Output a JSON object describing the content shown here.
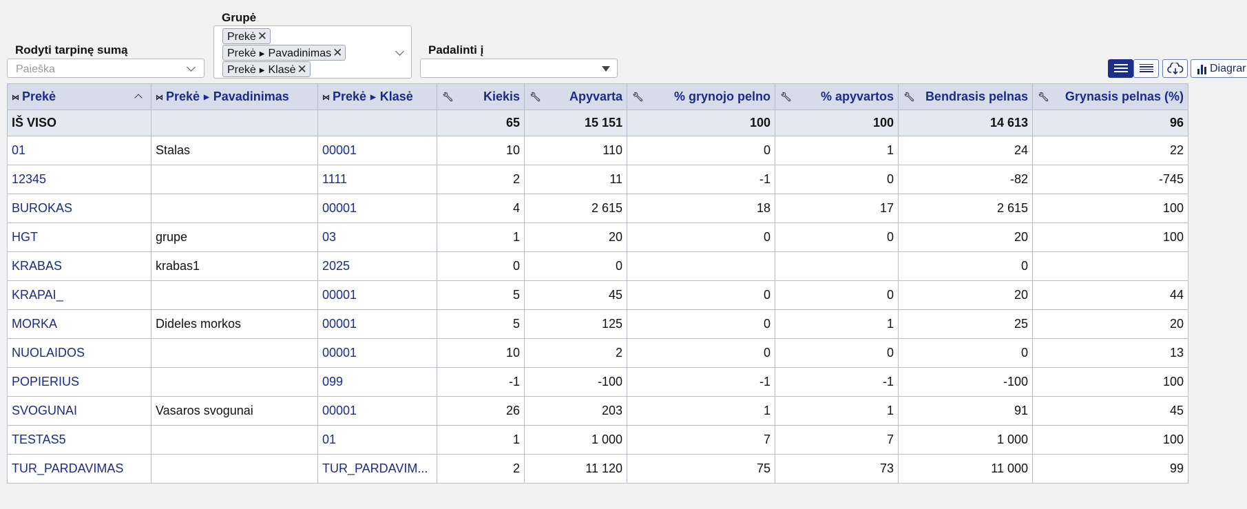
{
  "filters": {
    "subtotal_label": "Rodyti tarpinę sumą",
    "subtotal_placeholder": "Paieška",
    "group_label": "Grupė",
    "group_tags": [
      {
        "parts": [
          "Prekė"
        ]
      },
      {
        "parts": [
          "Prekė",
          "Pavadinimas"
        ]
      },
      {
        "parts": [
          "Prekė",
          "Klasė"
        ]
      }
    ],
    "split_label": "Padalinti į",
    "split_value": ""
  },
  "toolbar": {
    "diagram_label": "Diagrar"
  },
  "table": {
    "columns": [
      "Prekė",
      "Pavadinimas",
      "Klasė",
      "Kiekis",
      "Apyvarta",
      "% grynojo pelno",
      "% apyvartos",
      "Bendrasis pelnas",
      "Grynasis pelnas (%)"
    ],
    "column_prefix": "Prekė",
    "total": {
      "label": "IŠ VISO",
      "kiekis": "65",
      "apyvarta": "15 151",
      "gryn_pct": "100",
      "apyv_pct": "100",
      "bendr": "14 613",
      "gryn_pelnas": "96"
    },
    "rows": [
      {
        "preke": "01",
        "pav": "Stalas",
        "klase": "00001",
        "kiekis": "10",
        "apyvarta": "110",
        "gryn_pct": "0",
        "apyv_pct": "1",
        "bendr": "24",
        "gryn_pelnas": "22"
      },
      {
        "preke": "12345",
        "pav": "",
        "klase": "1111",
        "kiekis": "2",
        "apyvarta": "11",
        "gryn_pct": "-1",
        "apyv_pct": "0",
        "bendr": "-82",
        "gryn_pelnas": "-745"
      },
      {
        "preke": "BUROKAS",
        "pav": "",
        "klase": "00001",
        "kiekis": "4",
        "apyvarta": "2 615",
        "gryn_pct": "18",
        "apyv_pct": "17",
        "bendr": "2 615",
        "gryn_pelnas": "100"
      },
      {
        "preke": "HGT",
        "pav": "grupe",
        "klase": "03",
        "kiekis": "1",
        "apyvarta": "20",
        "gryn_pct": "0",
        "apyv_pct": "0",
        "bendr": "20",
        "gryn_pelnas": "100"
      },
      {
        "preke": "KRABAS",
        "pav": "krabas1",
        "klase": "2025",
        "kiekis": "0",
        "apyvarta": "0",
        "gryn_pct": "",
        "apyv_pct": "",
        "bendr": "0",
        "gryn_pelnas": ""
      },
      {
        "preke": "KRAPAI_",
        "pav": "",
        "klase": "00001",
        "kiekis": "5",
        "apyvarta": "45",
        "gryn_pct": "0",
        "apyv_pct": "0",
        "bendr": "20",
        "gryn_pelnas": "44"
      },
      {
        "preke": "MORKA",
        "pav": "Dideles morkos",
        "klase": "00001",
        "kiekis": "5",
        "apyvarta": "125",
        "gryn_pct": "0",
        "apyv_pct": "1",
        "bendr": "25",
        "gryn_pelnas": "20"
      },
      {
        "preke": "NUOLAIDOS",
        "pav": "",
        "klase": "00001",
        "kiekis": "10",
        "apyvarta": "2",
        "gryn_pct": "0",
        "apyv_pct": "0",
        "bendr": "0",
        "gryn_pelnas": "13"
      },
      {
        "preke": "POPIERIUS",
        "pav": "",
        "klase": "099",
        "kiekis": "-1",
        "apyvarta": "-100",
        "gryn_pct": "-1",
        "apyv_pct": "-1",
        "bendr": "-100",
        "gryn_pelnas": "100"
      },
      {
        "preke": "SVOGUNAI",
        "pav": "Vasaros svogunai",
        "klase": "00001",
        "kiekis": "26",
        "apyvarta": "203",
        "gryn_pct": "1",
        "apyv_pct": "1",
        "bendr": "91",
        "gryn_pelnas": "45"
      },
      {
        "preke": "TESTAS5",
        "pav": "",
        "klase": "01",
        "kiekis": "1",
        "apyvarta": "1 000",
        "gryn_pct": "7",
        "apyv_pct": "7",
        "bendr": "1 000",
        "gryn_pelnas": "100"
      },
      {
        "preke": "TUR_PARDAVIMAS",
        "pav": "",
        "klase": "TUR_PARDAVIM...",
        "kiekis": "2",
        "apyvarta": "11 120",
        "gryn_pct": "75",
        "apyv_pct": "73",
        "bendr": "11 000",
        "gryn_pelnas": "99"
      }
    ]
  }
}
